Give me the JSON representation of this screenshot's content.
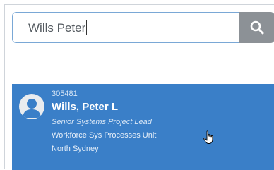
{
  "search": {
    "value": "Wills Peter",
    "button_icon": "search-icon"
  },
  "colors": {
    "result_bg": "#3a7fc8",
    "search_button_bg": "#8c9196",
    "search_border": "#7aa8d6"
  },
  "results": [
    {
      "id": "305481",
      "name": "Wills, Peter L",
      "title": "Senior Systems Project Lead",
      "unit": "Workforce Sys Processes Unit",
      "location": "North Sydney",
      "avatar_icon": "person-icon"
    }
  ]
}
